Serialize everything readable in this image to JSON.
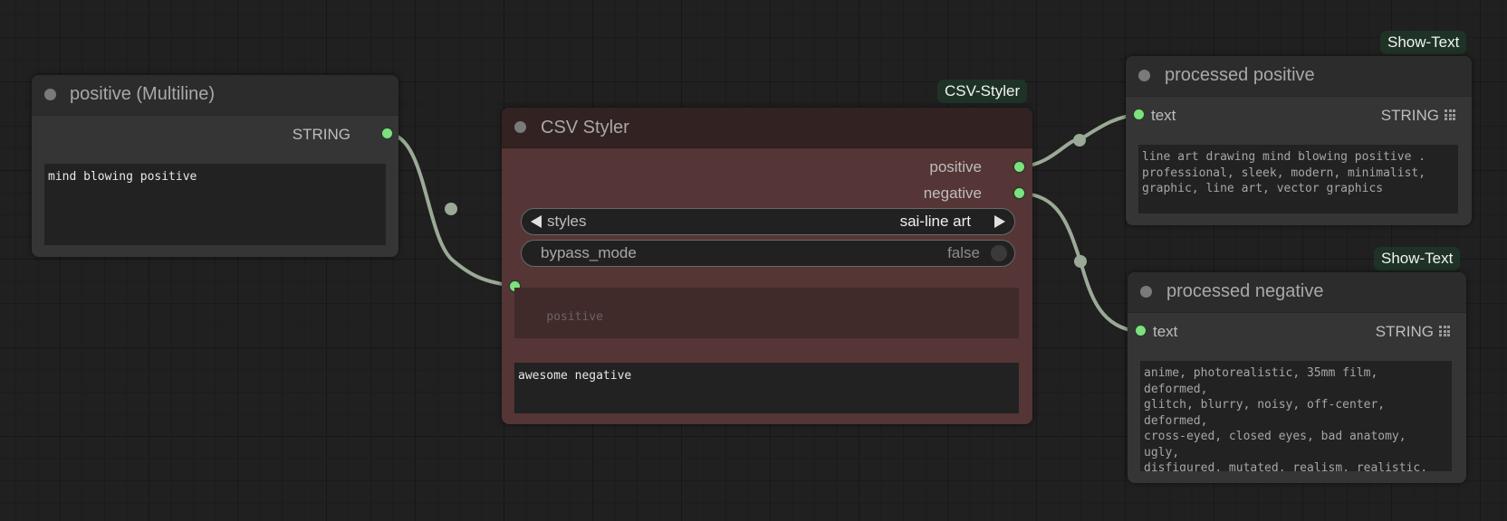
{
  "nodes": {
    "positive_multiline": {
      "title": "positive (Multiline)",
      "output_label": "STRING",
      "text_value": "mind blowing positive"
    },
    "csv_styler": {
      "badge": "CSV-Styler",
      "title": "CSV Styler",
      "outputs": [
        "positive",
        "negative"
      ],
      "styles": {
        "label": "styles",
        "value": "sai-line art"
      },
      "bypass_mode": {
        "label": "bypass_mode",
        "value": "false"
      },
      "positive_placeholder": "positive",
      "negative_value": "awesome negative"
    },
    "processed_positive": {
      "badge": "Show-Text",
      "title": "processed positive",
      "input_label": "text",
      "output_label": "STRING",
      "text": "line art drawing mind blowing positive .\nprofessional, sleek, modern, minimalist,\ngraphic, line art, vector graphics"
    },
    "processed_negative": {
      "badge": "Show-Text",
      "title": "processed negative",
      "input_label": "text",
      "output_label": "STRING",
      "text": "anime, photorealistic, 35mm film, deformed,\nglitch, blurry, noisy, off-center, deformed,\ncross-eyed, closed eyes, bad anatomy, ugly,\ndisfigured, mutated, realism, realistic,\nimpressionism, expressionism, oil, acrylic,\nawesome negative"
    }
  },
  "colors": {
    "canvas": "#202020",
    "node_body": "#353535",
    "node_title": "#2c2c2c",
    "styler_body": "#553535",
    "styler_title": "#332222",
    "link": "#9aaa96",
    "slot": "#7ee07e",
    "badge_bg": "#1e3326"
  }
}
